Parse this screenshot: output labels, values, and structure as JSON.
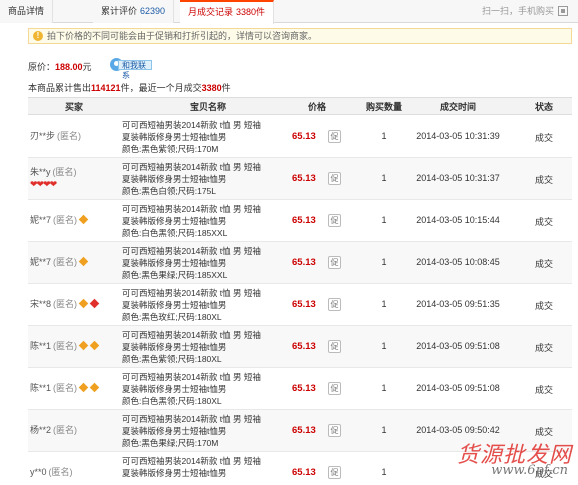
{
  "tabs": [
    {
      "label": "商品详情",
      "count": ""
    },
    {
      "label": "累计评价",
      "count": "62390"
    },
    {
      "label": "月成交记录",
      "count": "3380件"
    }
  ],
  "scan_label": "扫一扫，手机购买",
  "notice": "拍下价格的不同可能会由于促销和打折引起的，详情可以咨询商家。",
  "original_price_label": "原价：",
  "original_price": "188.00",
  "price_unit": "元",
  "contact_label": "和我联系",
  "summary": {
    "prefix": "本商品累计售出",
    "total": "114121",
    "middle": "件，最近一个月成交",
    "month": "3380",
    "suffix": "件"
  },
  "columns": {
    "buyer": "买家",
    "item": "宝贝名称",
    "price": "价格",
    "qty": "购买数量",
    "time": "成交时间",
    "status": "状态"
  },
  "rows": [
    {
      "buyer": "刃**步",
      "anon": "(匿名)",
      "item1": "可可西短袖男装2014新款 t恤 男 短袖",
      "item2": "夏装韩版修身男士短袖t恤男",
      "item3": "颜色:黑色紫领;尺码:170M",
      "price": "65.13",
      "promo": "促",
      "qty": "1",
      "time": "2014-03-05 10:31:39",
      "status": "成交"
    },
    {
      "buyer": "朱**y",
      "anon": "(匿名)",
      "hearts": "❤❤❤❤",
      "item1": "可可西短袖男装2014新款 t恤 男 短袖",
      "item2": "夏装韩版修身男士短袖t恤男",
      "item3": "颜色:黑色白领;尺码:175L",
      "price": "65.13",
      "promo": "促",
      "qty": "1",
      "time": "2014-03-05 10:31:37",
      "status": "成交"
    },
    {
      "buyer": "妮**7",
      "anon": "(匿名)",
      "item1": "可可西短袖男装2014新款 t恤 男 短袖",
      "item2": "夏装韩版修身男士短袖t恤男",
      "item3": "颜色:白色黑领;尺码:185XXL",
      "price": "65.13",
      "promo": "促",
      "qty": "1",
      "time": "2014-03-05 10:15:44",
      "status": "成交"
    },
    {
      "buyer": "妮**7",
      "anon": "(匿名)",
      "item1": "可可西短袖男装2014新款 t恤 男 短袖",
      "item2": "夏装韩版修身男士短袖t恤男",
      "item3": "颜色:黑色果绿;尺码:185XXL",
      "price": "65.13",
      "promo": "促",
      "qty": "1",
      "time": "2014-03-05 10:08:45",
      "status": "成交"
    },
    {
      "buyer": "宋**8",
      "anon": "(匿名)",
      "item1": "可可西短袖男装2014新款 t恤 男 短袖",
      "item2": "夏装韩版修身男士短袖t恤男",
      "item3": "颜色:黑色玫红;尺码:180XL",
      "price": "65.13",
      "promo": "促",
      "qty": "1",
      "time": "2014-03-05 09:51:35",
      "status": "成交"
    },
    {
      "buyer": "陈**1",
      "anon": "(匿名)",
      "item1": "可可西短袖男装2014新款 t恤 男 短袖",
      "item2": "夏装韩版修身男士短袖t恤男",
      "item3": "颜色:黑色紫领;尺码:180XL",
      "price": "65.13",
      "promo": "促",
      "qty": "1",
      "time": "2014-03-05 09:51:08",
      "status": "成交"
    },
    {
      "buyer": "陈**1",
      "anon": "(匿名)",
      "item1": "可可西短袖男装2014新款 t恤 男 短袖",
      "item2": "夏装韩版修身男士短袖t恤男",
      "item3": "颜色:白色黑领;尺码:180XL",
      "price": "65.13",
      "promo": "促",
      "qty": "1",
      "time": "2014-03-05 09:51:08",
      "status": "成交"
    },
    {
      "buyer": "杨**2",
      "anon": "(匿名)",
      "item1": "可可西短袖男装2014新款 t恤 男 短袖",
      "item2": "夏装韩版修身男士短袖t恤男",
      "item3": "颜色:黑色果绿;尺码:170M",
      "price": "65.13",
      "promo": "促",
      "qty": "1",
      "time": "2014-03-05 09:50:42",
      "status": "成交"
    },
    {
      "buyer": "y**0",
      "anon": "(匿名)",
      "item1": "可可西短袖男装2014新款 t恤 男 短袖",
      "item2": "夏装韩版修身男士短袖t恤男",
      "item3": "",
      "price": "65.13",
      "promo": "促",
      "qty": "1",
      "time": "",
      "status": "成交"
    }
  ],
  "watermark": {
    "title": "货源批发网",
    "url": "www.6pf.cn"
  }
}
